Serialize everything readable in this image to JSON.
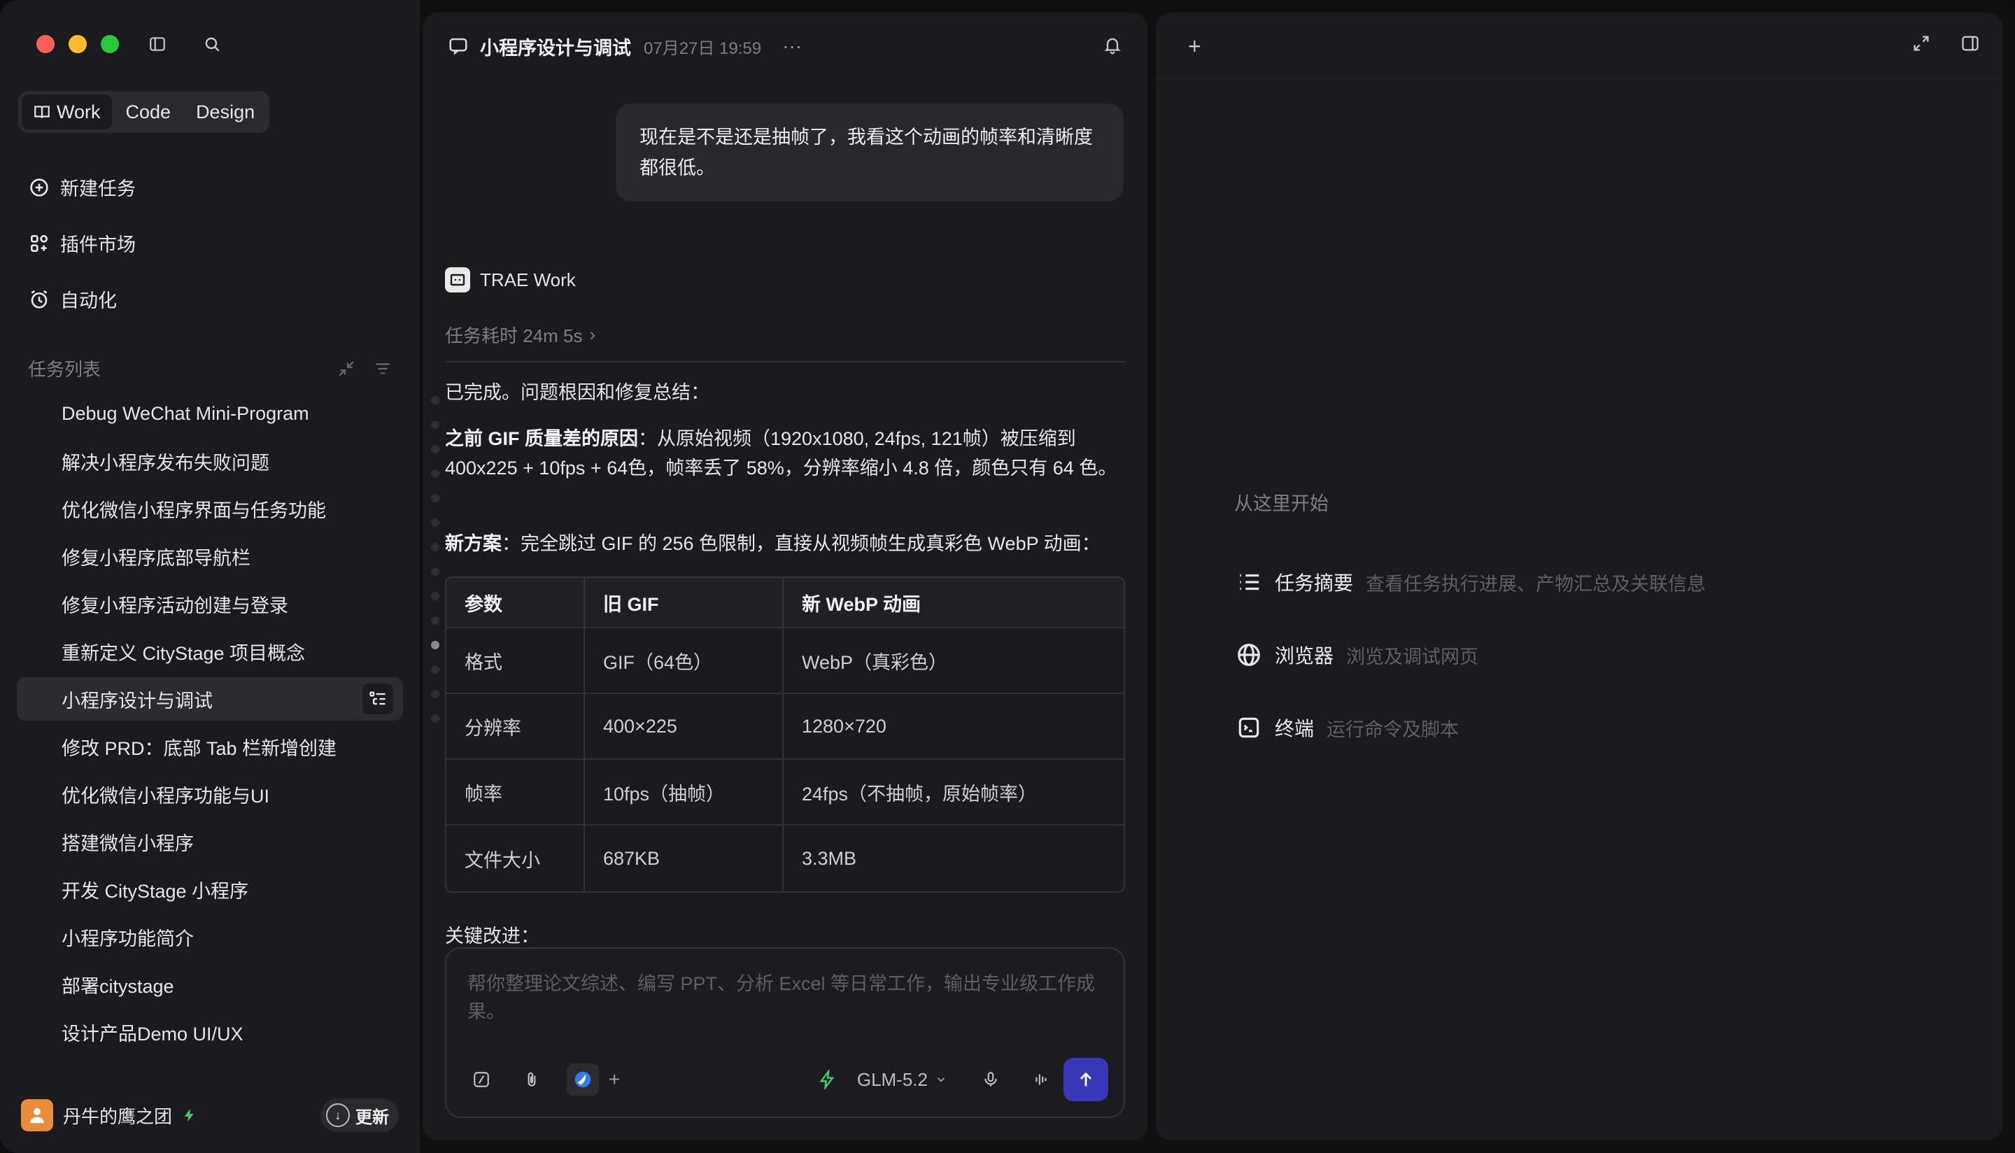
{
  "sidebar": {
    "mode_tabs": [
      {
        "label": "Work",
        "active": true
      },
      {
        "label": "Code",
        "active": false
      },
      {
        "label": "Design",
        "active": false
      }
    ],
    "nav": {
      "new_task": "新建任务",
      "plugin_market": "插件市场",
      "automation": "自动化"
    },
    "task_list_title": "任务列表",
    "tasks": [
      "Debug WeChat Mini-Program",
      "解决小程序发布失败问题",
      "优化微信小程序界面与任务功能",
      "修复小程序底部导航栏",
      "修复小程序活动创建与登录",
      "重新定义 CityStage 项目概念",
      "小程序设计与调试",
      "修改 PRD：底部 Tab 栏新增创建",
      "优化微信小程序功能与UI",
      "搭建微信小程序",
      "开发 CityStage 小程序",
      "小程序功能简介",
      "部署citystage",
      "设计产品Demo UI/UX"
    ],
    "active_task_index": 6,
    "user": {
      "name": "丹牛的鹰之团",
      "update_label": "更新"
    }
  },
  "chat": {
    "title": "小程序设计与调试",
    "time": "07月27日 19:59",
    "user_message": "现在是不是还是抽帧了，我看这个动画的帧率和清晰度都很低。",
    "agent_name": "TRAE Work",
    "duration": "任务耗时 24m 5s",
    "summary_intro": "已完成。问题根因和修复总结：",
    "cause_label": "之前 GIF 质量差的原因",
    "cause_text": "：从原始视频（1920x1080, 24fps, 121帧）被压缩到 400x225 + 10fps + 64色，帧率丢了 58%，分辨率缩小 4.8 倍，颜色只有 64 色。",
    "solution_label": "新方案",
    "solution_text": "：完全跳过 GIF 的 256 色限制，直接从视频帧生成真彩色 WebP 动画：",
    "table": {
      "headers": [
        "参数",
        "旧 GIF",
        "新 WebP 动画"
      ],
      "rows": [
        [
          "格式",
          "GIF（64色）",
          "WebP（真彩色）"
        ],
        [
          "分辨率",
          "400×225",
          "1280×720"
        ],
        [
          "帧率",
          "10fps（抽帧）",
          "24fps（不抽帧，原始帧率）"
        ],
        [
          "文件大小",
          "687KB",
          "3.3MB"
        ]
      ]
    },
    "key_improvements": "关键改进：",
    "composer": {
      "placeholder": "帮你整理论文综述、编写 PPT、分析 Excel 等日常工作，输出专业级工作成果。",
      "model": "GLM-5.2"
    }
  },
  "right_panel": {
    "start_label": "从这里开始",
    "features": [
      {
        "title": "任务摘要",
        "desc": "查看任务执行进展、产物汇总及关联信息",
        "icon": "list-icon"
      },
      {
        "title": "浏览器",
        "desc": "浏览及调试网页",
        "icon": "globe-icon"
      },
      {
        "title": "终端",
        "desc": "运行命令及脚本",
        "icon": "terminal-icon"
      }
    ]
  },
  "colors": {
    "accent": "#3a36b8",
    "bolt": "#3ecf6f"
  }
}
